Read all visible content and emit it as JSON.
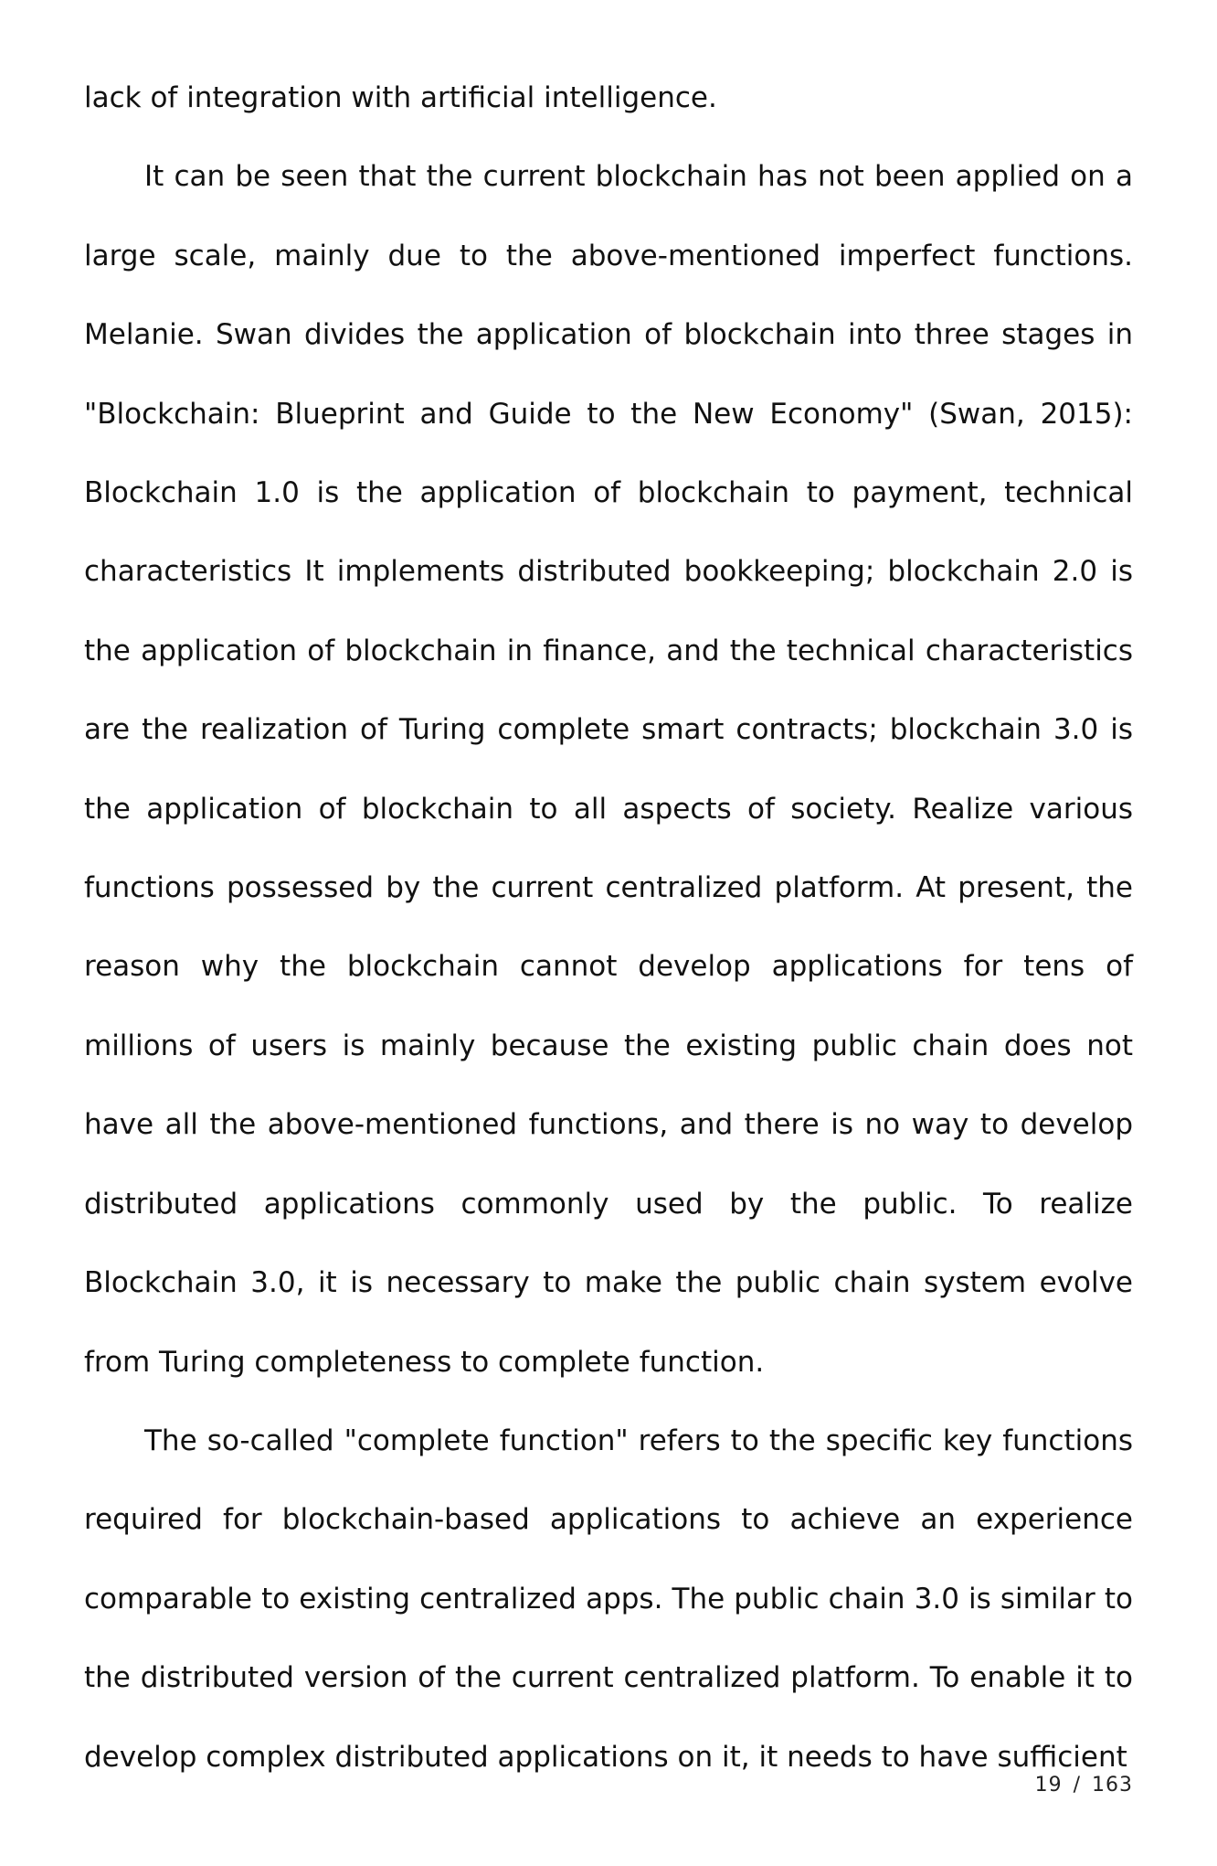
{
  "document": {
    "paragraphs": [
      "lack of integration with artificial intelligence.",
      "It can be seen that the current blockchain has not been applied on a large scale, mainly due to the above-mentioned imperfect functions. Melanie. Swan divides the application of blockchain into three stages in \"Blockchain: Blueprint and Guide to the New Economy\" (Swan, 2015): Blockchain 1.0 is the application of blockchain to payment, technical characteristics It implements distributed bookkeeping; blockchain 2.0 is the application of blockchain in finance, and the technical characteristics are the realization of Turing complete smart contracts; blockchain 3.0 is the application of blockchain to all aspects of society. Realize various functions possessed by the current centralized platform. At present, the reason why the blockchain cannot develop applications for tens of millions of users is mainly because the existing public chain does not have all the above-mentioned functions, and there is no way to develop distributed applications commonly used by the public. To realize Blockchain 3.0, it is necessary to make the public chain system evolve from Turing completeness to complete function.",
      "The so-called \"complete function\" refers to the specific key functions required for blockchain-based applications to achieve an experience comparable to existing centralized apps. The public chain 3.0 is similar to the distributed version of the current centralized platform. To enable it to develop complex distributed applications on it, it needs to have sufficient"
    ]
  },
  "footer": {
    "current_page": "19",
    "separator": "/",
    "total_pages": "163"
  }
}
